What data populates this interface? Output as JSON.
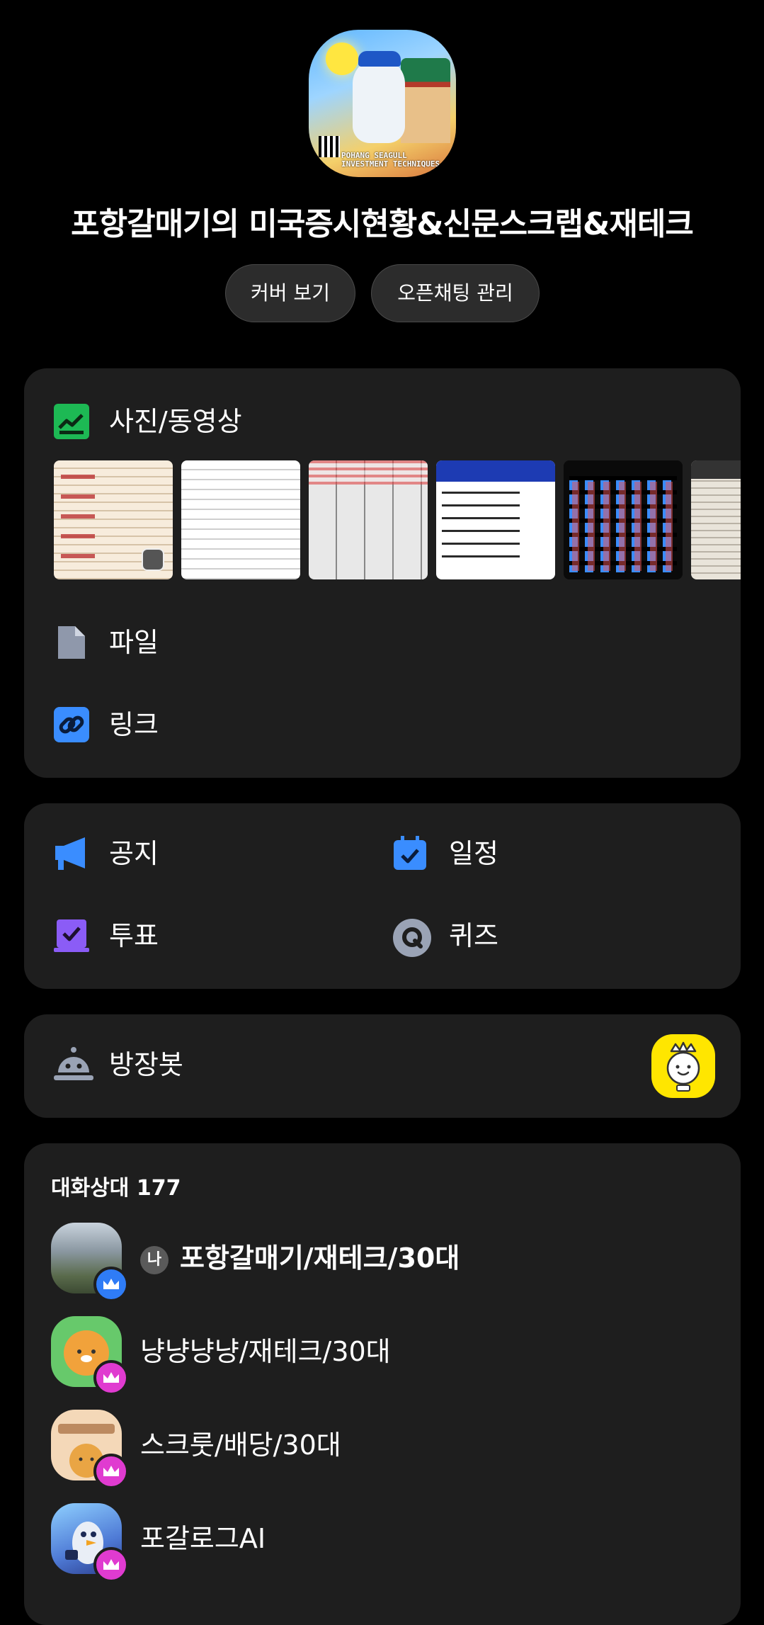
{
  "room": {
    "title": "포항갈매기의 미국증시현황&신문스크랩&재테크",
    "image_caption_line1": "POHANG SEAGULL",
    "image_caption_line2": "INVESTMENT TECHNIQUES"
  },
  "actions": {
    "view_cover": "커버 보기",
    "manage_chat": "오픈채팅 관리"
  },
  "media": {
    "photos_label": "사진/동영상",
    "files_label": "파일",
    "links_label": "링크"
  },
  "features": {
    "notice_label": "공지",
    "schedule_label": "일정",
    "vote_label": "투표",
    "quiz_label": "퀴즈"
  },
  "bot": {
    "label": "방장봇"
  },
  "members": {
    "header": "대화상대 177",
    "me_badge": "나",
    "list": [
      {
        "name": "포항갈매기/재테크/30대",
        "is_me": true,
        "crown_color": "#2f7cf6"
      },
      {
        "name": "냥냥냥냥/재테크/30대",
        "is_me": false,
        "crown_color": "#e03bd0"
      },
      {
        "name": "스크룻/배당/30대",
        "is_me": false,
        "crown_color": "#e03bd0"
      },
      {
        "name": "포갈로그AI",
        "is_me": false,
        "crown_color": "#e03bd0"
      }
    ]
  },
  "colors": {
    "background": "#000000",
    "card": "#1e1e1e",
    "photos_icon": "#1db954",
    "link_icon": "#3a8dff",
    "notice_icon": "#3a8dff",
    "schedule_icon": "#3a8dff",
    "vote_icon": "#8b5cf6",
    "quiz_icon": "#9aa3b5",
    "bot_badge": "#ffe600"
  }
}
